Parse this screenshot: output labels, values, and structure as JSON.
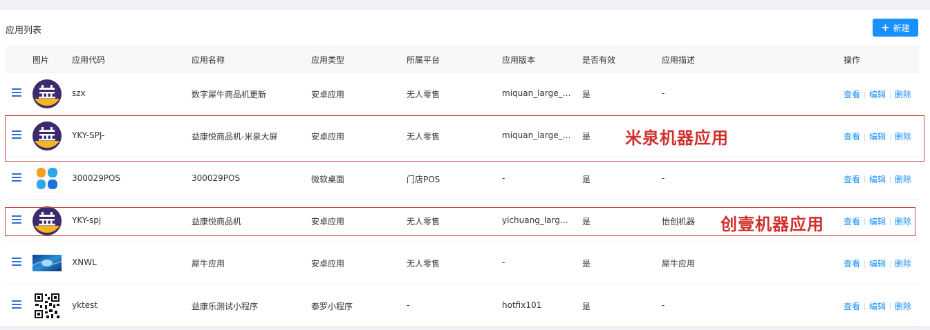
{
  "page_title": "应用列表",
  "new_button_label": "新建",
  "columns": {
    "image": "图片",
    "code": "应用代码",
    "name": "应用名称",
    "type": "应用类型",
    "platform": "所属平台",
    "version": "应用版本",
    "valid": "是否有效",
    "desc": "应用描述",
    "actions": "操作"
  },
  "actions": {
    "view": "查看",
    "edit": "编辑",
    "delete": "删除"
  },
  "rows": [
    {
      "icon": "yikang-logo-icon",
      "code": "szx",
      "name": "数字犀牛商品机更新",
      "type": "安卓应用",
      "platform": "无人零售",
      "version": "miquan_large_prd...",
      "valid": "是",
      "desc": "-"
    },
    {
      "icon": "yikang-logo-icon",
      "code": "YKY-SPJ-",
      "name": "益康悦商品机-米泉大屏",
      "type": "安卓应用",
      "platform": "无人零售",
      "version": "miquan_large_prd...",
      "valid": "是",
      "desc": ""
    },
    {
      "icon": "grid-app-icon",
      "code": "300029POS",
      "name": "300029POS",
      "type": "微软桌面",
      "platform": "门店POS",
      "version": "-",
      "valid": "是",
      "desc": "-"
    },
    {
      "icon": "yikang-logo-icon",
      "code": "YKY-spj",
      "name": "益康悦商品机",
      "type": "安卓应用",
      "platform": "无人零售",
      "version": "yichuang_large_pr...",
      "valid": "是",
      "desc": "怡创机器"
    },
    {
      "icon": "blue-banner-image",
      "code": "XNWL",
      "name": "犀牛应用",
      "type": "安卓应用",
      "platform": "无人零售",
      "version": "-",
      "valid": "是",
      "desc": "犀牛应用"
    },
    {
      "icon": "qr-code-icon",
      "code": "yktest",
      "name": "益康乐测试小程序",
      "type": "泰罗小程序",
      "platform": "-",
      "version": "hotfix101",
      "valid": "是",
      "desc": "-"
    }
  ],
  "annotations": {
    "first": "米泉机器应用",
    "second": "创壹机器应用"
  },
  "colors": {
    "primary": "#1890ff",
    "annotation": "#d0302b",
    "drag_handle": "#2f6fd6",
    "logo_purple": "#3d2a6e",
    "logo_yellow": "#f5b51c"
  }
}
